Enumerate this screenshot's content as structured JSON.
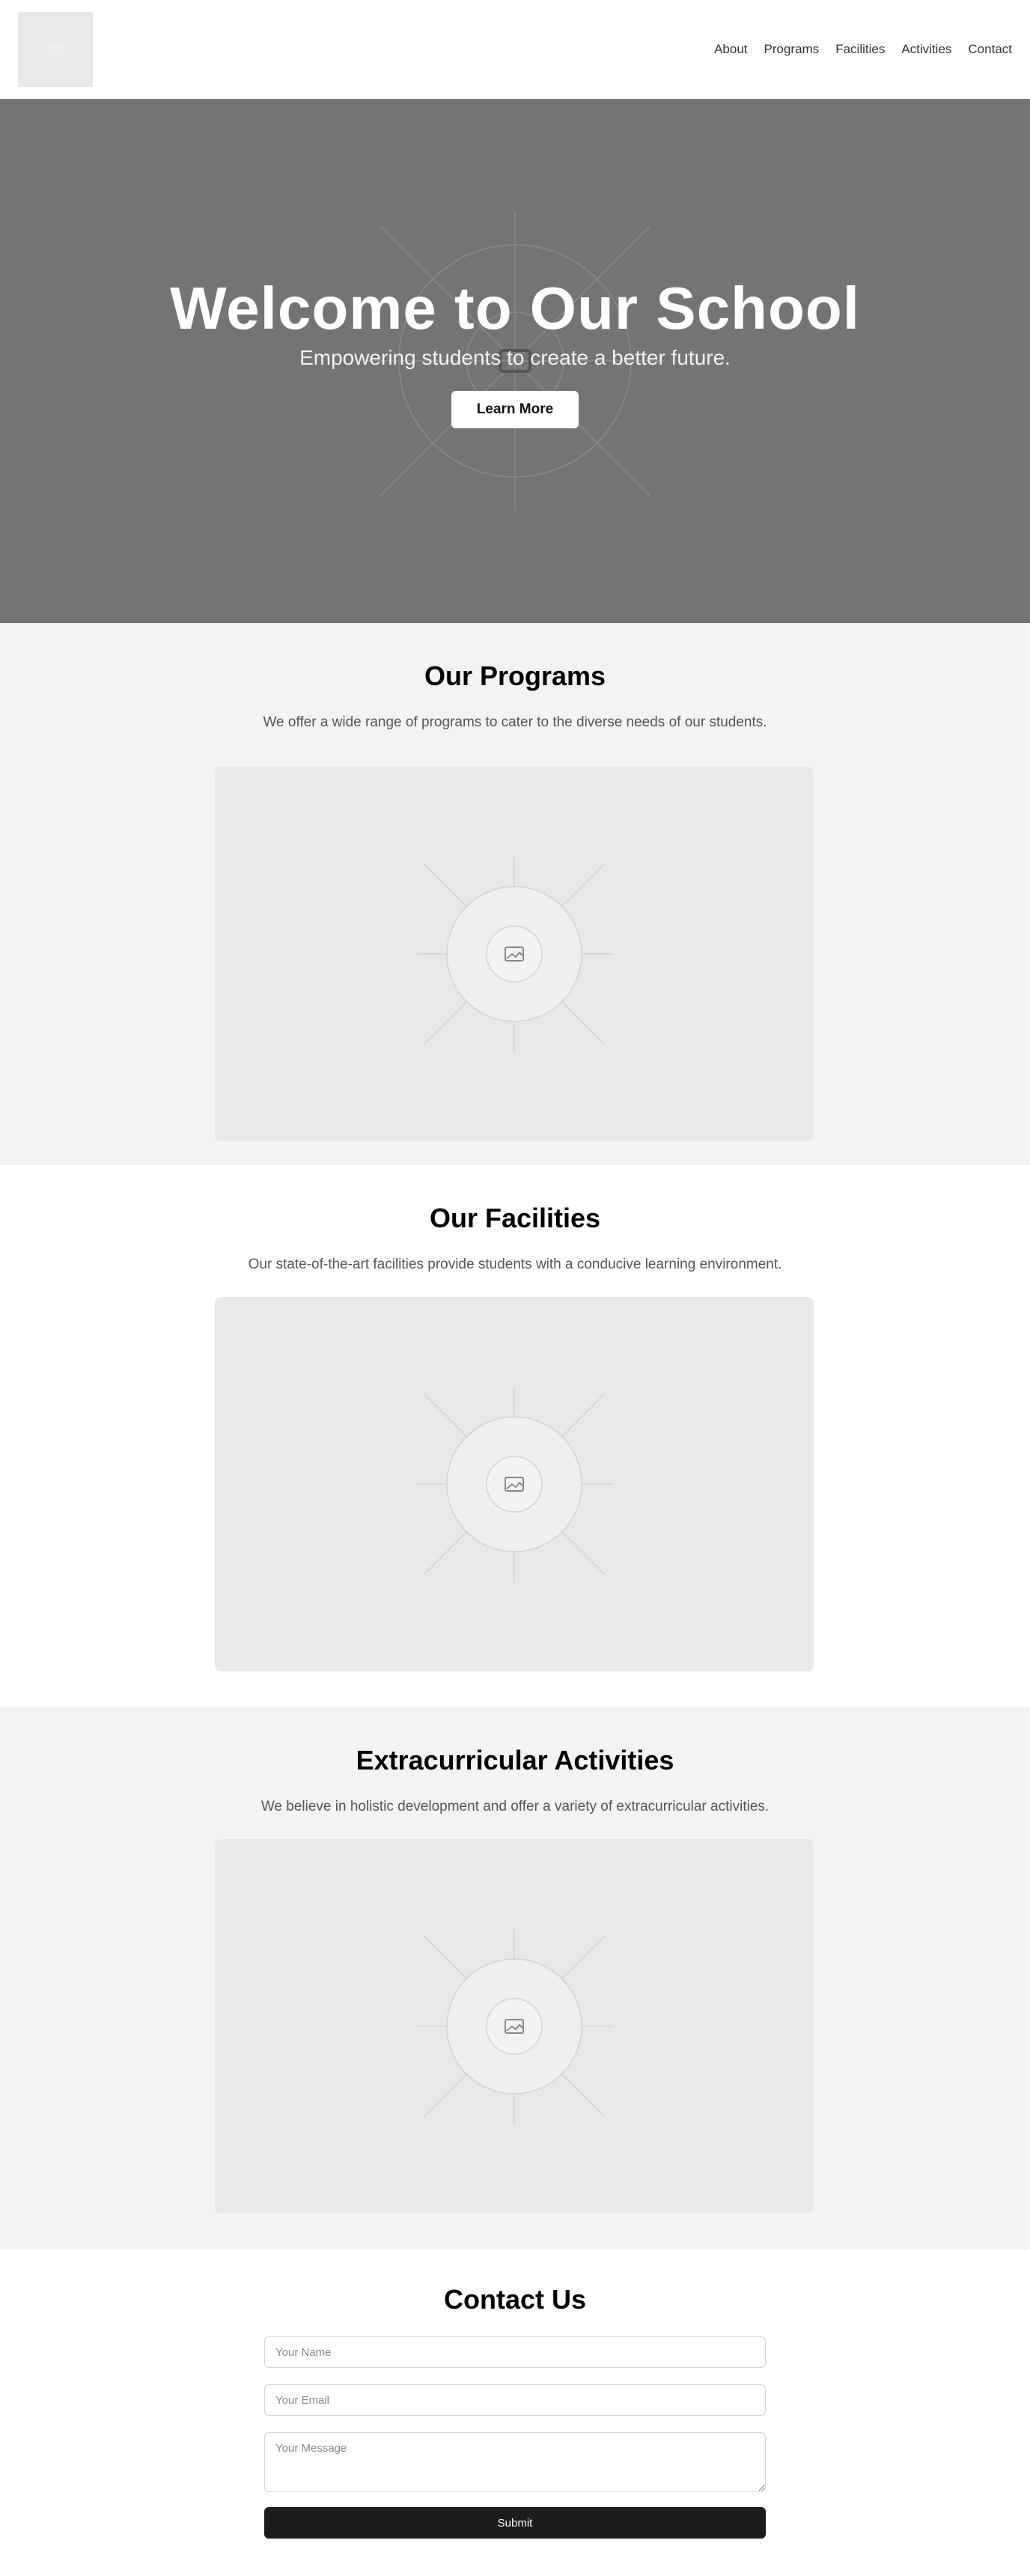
{
  "nav": {
    "items": [
      {
        "label": "About"
      },
      {
        "label": "Programs"
      },
      {
        "label": "Facilities"
      },
      {
        "label": "Activities"
      },
      {
        "label": "Contact"
      }
    ]
  },
  "hero": {
    "title": "Welcome to Our School",
    "subtitle": "Empowering students to create a better future.",
    "button_label": "Learn More"
  },
  "programs": {
    "title": "Our Programs",
    "text": "We offer a wide range of programs to cater to the diverse needs of our students."
  },
  "facilities": {
    "title": "Our Facilities",
    "text": "Our state-of-the-art facilities provide students with a conducive learning environment."
  },
  "activities": {
    "title": "Extracurricular Activities",
    "text": "We believe in holistic development and offer a variety of extracurricular activities."
  },
  "contact": {
    "title": "Contact Us",
    "name_placeholder": "Your Name",
    "email_placeholder": "Your Email",
    "message_placeholder": "Your Message",
    "submit_label": "Submit"
  },
  "colors": {
    "hero_bg": "#747474",
    "alt_section_bg": "#f2f3f4",
    "placeholder_bg": "#e8e8e8",
    "submit_bg": "#1c1c1e"
  },
  "icons": {
    "image_placeholder": "image-placeholder-icon"
  }
}
